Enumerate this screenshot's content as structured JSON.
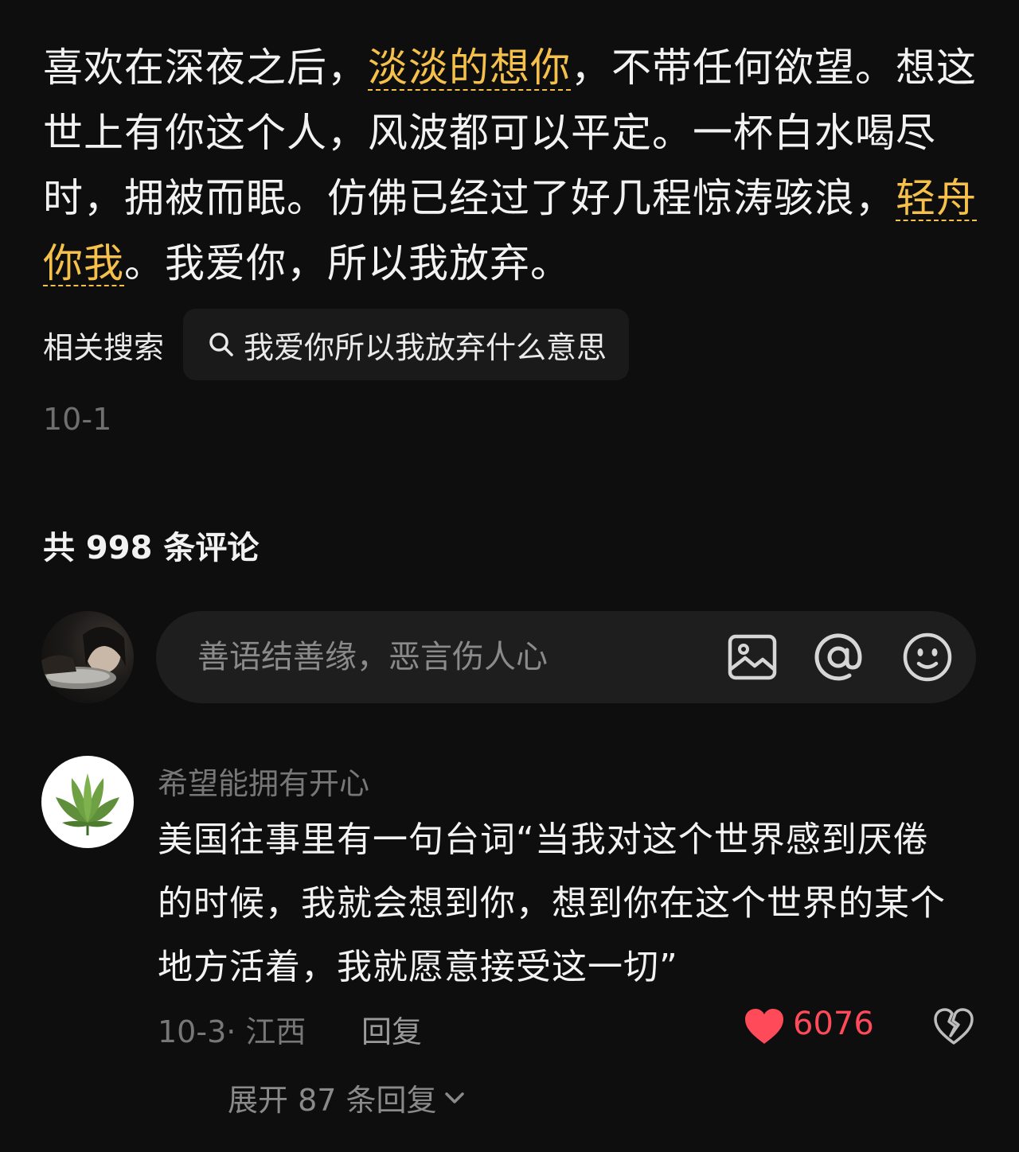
{
  "post": {
    "text_1": "喜欢在深夜之后，",
    "hl_1": "淡淡的想你",
    "text_2": "，不带任何欲望。想这世上有你这个人，风波都可以平定。一杯白水喝尽时，拥被而眠。仿佛已经过了好几程惊涛骇浪，",
    "hl_2": "轻舟你我",
    "text_3": "。我爱你，所以我放弃。",
    "date": "10-1"
  },
  "related": {
    "label": "相关搜索",
    "query": "我爱你所以我放弃什么意思",
    "icon": "search-icon"
  },
  "comments_header": {
    "count_text": "共 998 条评论"
  },
  "comment_input": {
    "placeholder": "善语结善缘，恶言伤人心",
    "icons": [
      "image-icon",
      "at-icon",
      "emoji-icon"
    ]
  },
  "comment": {
    "username": "希望能拥有开心",
    "text": "美国往事里有一句台词“当我对这个世界感到厌倦的时候，我就会想到你，想到你在这个世界的某个地方活着，我就愿意接受这一切”",
    "meta": "10-3· 江西",
    "reply_label": "回复",
    "like_count": "6076",
    "expand_label": "展开 87 条回复",
    "colors": {
      "like": "#ff4a5a"
    }
  },
  "colors": {
    "background": "#0e0e0e",
    "highlight": "#f5c14a"
  }
}
